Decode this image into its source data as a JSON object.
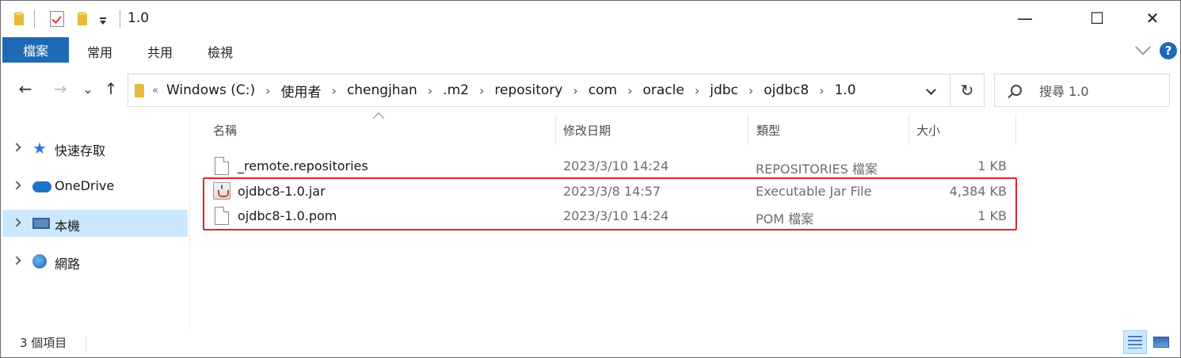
{
  "window": {
    "title": "1.0",
    "minimize": "—",
    "maximize": "☐",
    "close": "✕"
  },
  "ribbon": {
    "tabs": [
      "檔案",
      "常用",
      "共用",
      "檢視"
    ]
  },
  "nav": {
    "back": "←",
    "forward": "→",
    "recent": "⌄",
    "up": "↑"
  },
  "address": {
    "overflow": "«",
    "crumbs": [
      "Windows (C:)",
      "使用者",
      "chengjhan",
      ".m2",
      "repository",
      "com",
      "oracle",
      "jdbc",
      "ojdbc8",
      "1.0"
    ],
    "separator": "›",
    "refresh": "↻"
  },
  "search": {
    "placeholder": "搜尋 1.0"
  },
  "sidebar": {
    "items": [
      {
        "label": "快速存取",
        "icon": "star-icon",
        "selected": false
      },
      {
        "label": "OneDrive",
        "icon": "cloud-icon",
        "selected": false
      },
      {
        "label": "本機",
        "icon": "computer-icon",
        "selected": true
      },
      {
        "label": "網路",
        "icon": "network-icon",
        "selected": false
      }
    ]
  },
  "columns": {
    "name": "名稱",
    "date": "修改日期",
    "type": "類型",
    "size": "大小"
  },
  "files": [
    {
      "name": "_remote.repositories",
      "date": "2023/3/10 14:24",
      "type": "REPOSITORIES 檔案",
      "size": "1 KB",
      "icon": "file-icon"
    },
    {
      "name": "ojdbc8-1.0.jar",
      "date": "2023/3/8 14:57",
      "type": "Executable Jar File",
      "size": "4,384 KB",
      "icon": "jar-icon"
    },
    {
      "name": "ojdbc8-1.0.pom",
      "date": "2023/3/10 14:24",
      "type": "POM 檔案",
      "size": "1 KB",
      "icon": "file-icon"
    }
  ],
  "status": {
    "item_count": "3 個項目"
  },
  "colors": {
    "accent": "#1f6ab5",
    "selection": "#cce8ff",
    "highlight_box": "#e0242e"
  }
}
